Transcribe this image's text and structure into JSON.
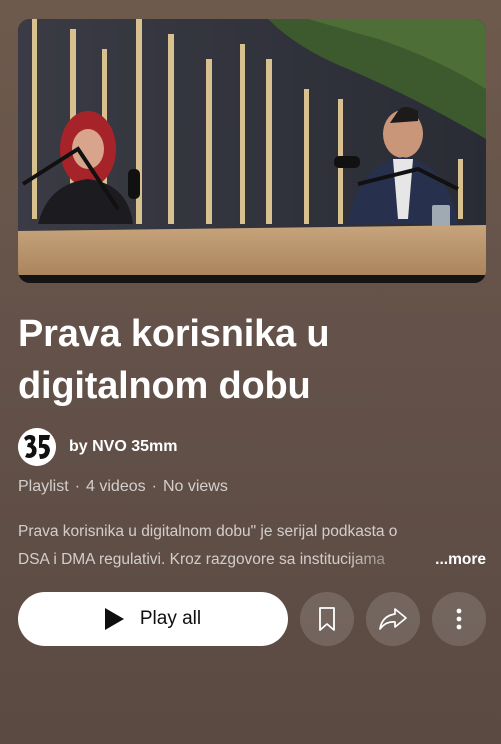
{
  "playlist": {
    "title": "Prava korisnika u digitalnom dobu",
    "owner": "by NVO 35mm",
    "meta": {
      "type": "Playlist",
      "video_count": "4 videos",
      "views": "No views",
      "separator": "·"
    },
    "description_line1": "Prava korisnika u digitalnom dobu\" je serijal podkasta o",
    "description_line2": "DSA i DMA regulativi. Kroz razgovore sa institucijama",
    "more_label": "...more"
  },
  "actions": {
    "play_all_label": "Play all",
    "save_icon": "bookmark-icon",
    "share_icon": "share-icon",
    "more_icon": "more-vertical-icon"
  },
  "colors": {
    "background": "#64524a",
    "primary_button": "#ffffff",
    "secondary_button": "rgba(255,255,255,0.14)"
  }
}
